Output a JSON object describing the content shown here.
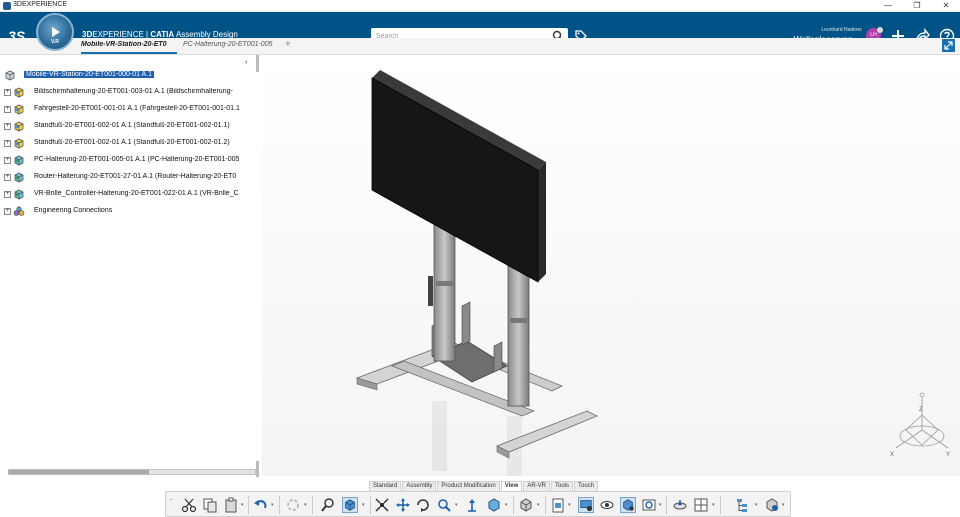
{
  "window": {
    "title": "3DEXPERIENCE",
    "controls": [
      "—",
      "❐",
      "✕"
    ]
  },
  "topbar": {
    "ds_logo": "3S",
    "app_title_bold": "3D",
    "app_title_rest": "EXPERIENCE | ",
    "app_brand": "CATIA",
    "app_module": " Assembly Design",
    "search_placeholder": "Search",
    "user_name": "Leonhard Haderer",
    "workspace": "Wellenlagerung",
    "avatar_initials": "LH",
    "compass_label": "V.R"
  },
  "tabs": [
    {
      "label": "Mobile-VR-Station-20-ET0"
    },
    {
      "label": "PC-Halterung-20-ET001-005"
    }
  ],
  "tab_add": "+",
  "tree": {
    "root": "Mobile-VR-Station-20-ET001-000-01 A.1",
    "items": [
      {
        "label": "Bildschirmhalterung-20-ET001-003-01 A.1 (Bildschirmhalterung-",
        "icon": "product-icon"
      },
      {
        "label": "Fahrgestell-20-ET001-001-01 A.1 (Fahrgestell-20-ET001-001-01.1",
        "icon": "product-icon"
      },
      {
        "label": "Standfuß-20-ET001-002-01 A.1 (Standfuß-20-ET001-002-01.1)",
        "icon": "product-icon"
      },
      {
        "label": "Standfuß-20-ET001-002-01 A.1 (Standfuß-20-ET001-002-01.2)",
        "icon": "product-icon"
      },
      {
        "label": "PC-Halterung-20-ET001-005-01 A.1 (PC-Halterung-20-ET001-005",
        "icon": "product-icon"
      },
      {
        "label": "Router-Halterung-20-ET001-27-01 A.1 (Router-Halterung-20-ET0",
        "icon": "product-icon"
      },
      {
        "label": "VR-Brille_Controller-Halterung-20-ET001-022-01 A.1 (VR-Brille_C",
        "icon": "product-icon"
      },
      {
        "label": "Engineering Connections",
        "icon": "connections-icon"
      }
    ]
  },
  "command_tabs": [
    "Standard",
    "Assembly",
    "Product Modification",
    "View",
    "AR-VR",
    "Tools",
    "Touch"
  ],
  "active_command_tab": "View",
  "compass_axes": {
    "x": "X",
    "y": "Y",
    "z": "Z"
  },
  "colors": {
    "brand_blue": "#005386",
    "selection": "#1f5fae",
    "accent_pink": "#b23ea8"
  }
}
